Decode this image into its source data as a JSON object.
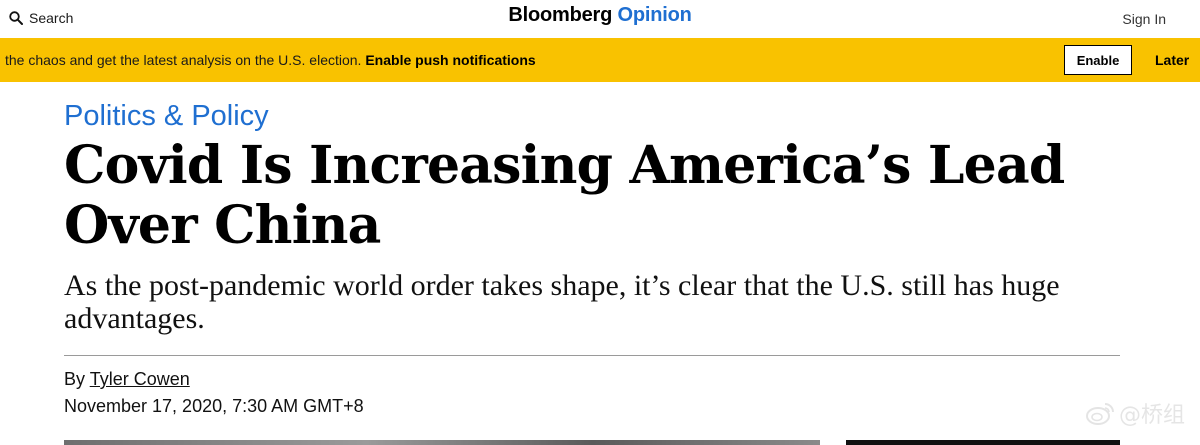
{
  "header": {
    "search_label": "Search",
    "brand_main": "Bloomberg",
    "brand_accent": "Opinion",
    "signin_label": "Sign In"
  },
  "banner": {
    "text": "the chaos and get the latest analysis on the U.S. election.",
    "link_label": "Enable push notifications",
    "enable_label": "Enable",
    "later_label": "Later"
  },
  "article": {
    "category": "Politics & Policy",
    "headline": "Covid Is Increasing America’s Lead Over China",
    "dek": "As the post-pandemic world order takes shape, it’s clear that the U.S. still has huge advantages.",
    "byline_prefix": "By",
    "author": "Tyler Cowen",
    "date": "November 17, 2020, 7:30 AM GMT+8"
  },
  "watermark": {
    "text": "@桥组"
  },
  "colors": {
    "accent": "#1f6fd1",
    "banner": "#f9c200"
  },
  "icons": {
    "search": "search-icon",
    "watermark": "weibo-icon"
  }
}
